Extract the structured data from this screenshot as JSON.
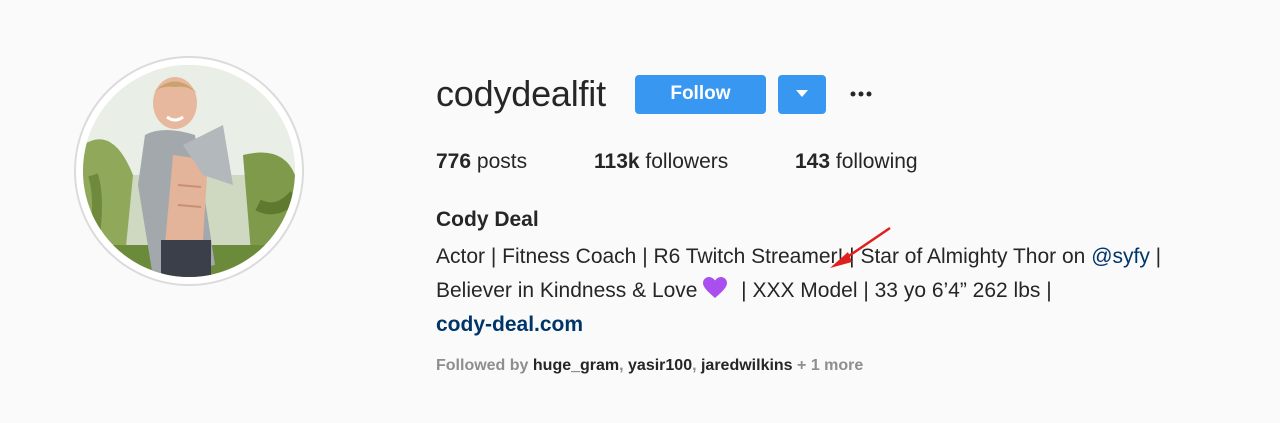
{
  "profile": {
    "username": "codydealfit",
    "full_name": "Cody Deal",
    "website": "cody-deal.com"
  },
  "actions": {
    "follow_label": "Follow",
    "more_icon": "more-horizontal-icon",
    "dropdown_icon": "caret-down-icon"
  },
  "stats": {
    "posts_count": "776",
    "posts_label": "posts",
    "followers_count": "113k",
    "followers_label": "followers",
    "following_count": "143",
    "following_label": "following"
  },
  "bio": {
    "line1_text": "Actor | Fitness Coach | R6 Twitch Streamer! | Star of Almighty Thor on ",
    "line1_mention": "@syfy",
    "line1_end": " |",
    "line2_start": "Believer in Kindness & Love ",
    "line2_end": " | XXX Model | 33 yo 6’4” 262 lbs |"
  },
  "followed_by": {
    "prefix": "Followed by ",
    "users": [
      "huge_gram",
      "yasir100",
      "jaredwilkins"
    ],
    "separator": ", ",
    "suffix": " + 1 more"
  },
  "colors": {
    "accent": "#3897f0",
    "link": "#003569",
    "annotation_arrow": "#e0201c",
    "heart": "#a94ff0"
  }
}
